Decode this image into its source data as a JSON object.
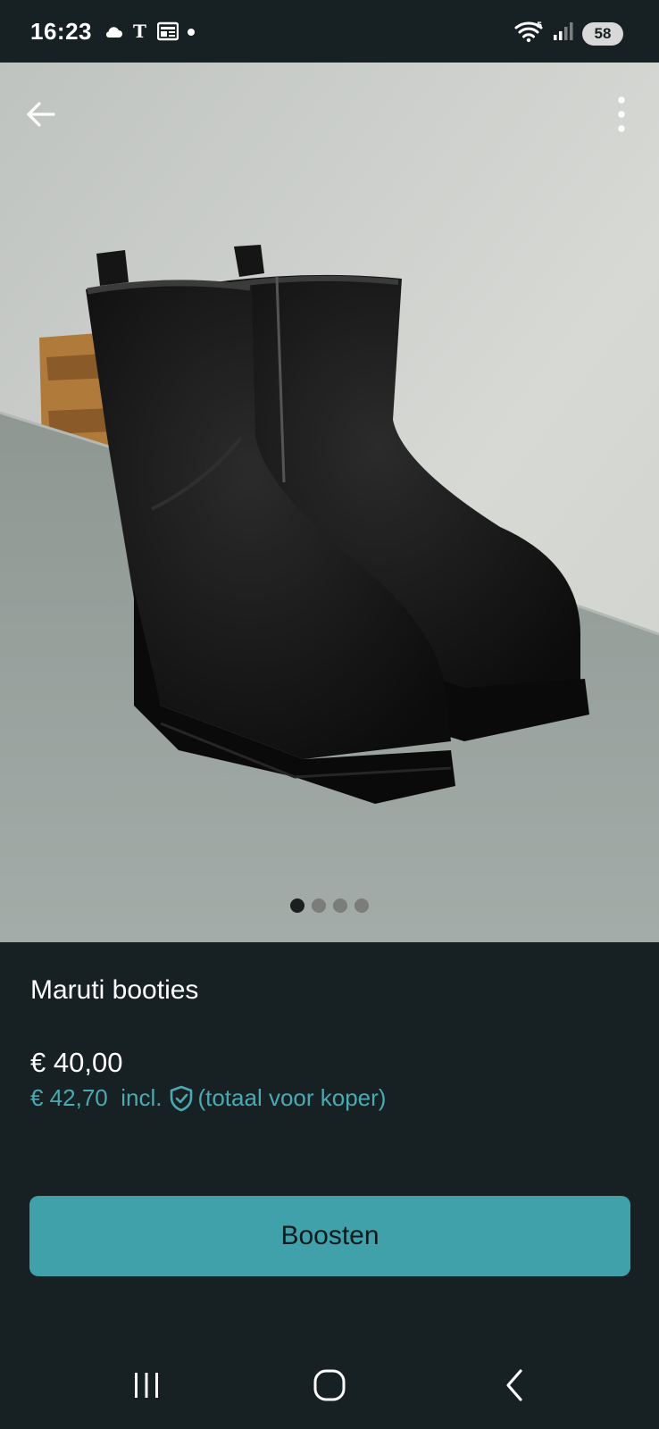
{
  "status_bar": {
    "time": "16:23",
    "battery": "58",
    "left_icons": [
      "cloud-icon",
      "telegraaf-icon",
      "news-icon",
      "dot-icon"
    ],
    "right_icons": [
      "wifi-icon",
      "signal-icon",
      "battery-icon"
    ]
  },
  "listing": {
    "title": "Maruti booties",
    "price": "€ 40,00",
    "price_incl_amount": "€ 42,70",
    "price_incl_label": "incl.",
    "price_incl_note": "(totaal voor koper)",
    "image_count": 4,
    "active_image": 1
  },
  "actions": {
    "boost_label": "Boosten"
  },
  "colors": {
    "background": "#172022",
    "accent": "#41a1ab",
    "accent_text": "#4aaab3"
  }
}
